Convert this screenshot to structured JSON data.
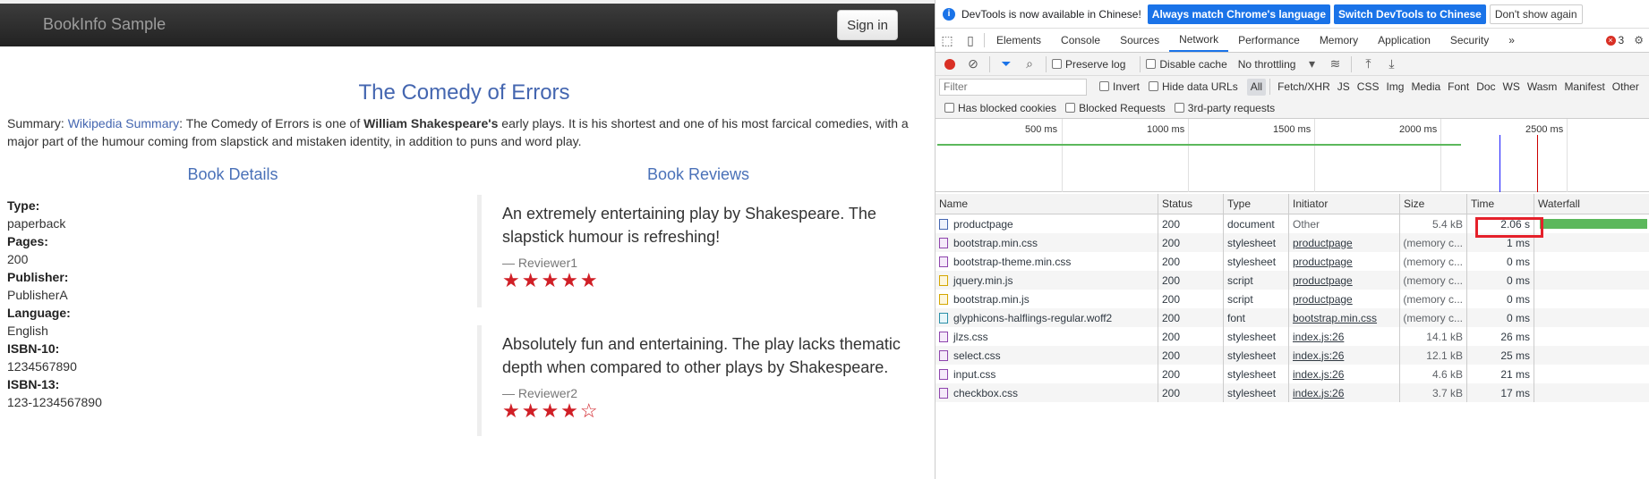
{
  "page": {
    "brand": "BookInfo Sample",
    "signin_label": "Sign in",
    "title": "The Comedy of Errors",
    "summary_prefix": "Summary: ",
    "summary_link": "Wikipedia Summary",
    "summary_text1": ": The Comedy of Errors is one of ",
    "summary_bold": "William Shakespeare's",
    "summary_text2": " early plays. It is his shortest and one of his most farcical comedies, with a major part of the humour coming from slapstick and mistaken identity, in addition to puns and word play.",
    "details_heading": "Book Details",
    "reviews_heading": "Book Reviews",
    "details": [
      {
        "label": "Type:",
        "value": "paperback"
      },
      {
        "label": "Pages:",
        "value": "200"
      },
      {
        "label": "Publisher:",
        "value": "PublisherA"
      },
      {
        "label": "Language:",
        "value": "English"
      },
      {
        "label": "ISBN-10:",
        "value": "1234567890"
      },
      {
        "label": "ISBN-13:",
        "value": "123-1234567890"
      }
    ],
    "reviews": [
      {
        "text": "An extremely entertaining play by Shakespeare. The slapstick humour is refreshing!",
        "author": "— Reviewer1",
        "rating": 5,
        "max": 5
      },
      {
        "text": "Absolutely fun and entertaining. The play lacks thematic depth when compared to other plays by Shakespeare.",
        "author": "— Reviewer2",
        "rating": 4,
        "max": 5
      }
    ],
    "star_color": "#d01f26"
  },
  "devtools": {
    "info_message": "DevTools is now available in Chinese!",
    "btn_match": "Always match Chrome's language",
    "btn_switch": "Switch DevTools to Chinese",
    "btn_dismiss": "Don't show again",
    "tabs": [
      "Elements",
      "Console",
      "Sources",
      "Network",
      "Performance",
      "Memory",
      "Application",
      "Security"
    ],
    "active_tab": "Network",
    "more_tabs": "»",
    "error_count": "3",
    "preserve_log": "Preserve log",
    "disable_cache": "Disable cache",
    "throttling": "No throttling",
    "filter_placeholder": "Filter",
    "invert": "Invert",
    "hide_data_urls": "Hide data URLs",
    "type_filters": [
      "All",
      "Fetch/XHR",
      "JS",
      "CSS",
      "Img",
      "Media",
      "Font",
      "Doc",
      "WS",
      "Wasm",
      "Manifest",
      "Other"
    ],
    "active_type": "All",
    "has_blocked_cookies": "Has blocked cookies",
    "blocked_requests": "Blocked Requests",
    "third_party": "3rd-party requests",
    "overview_labels": [
      "500 ms",
      "1000 ms",
      "1500 ms",
      "2000 ms",
      "2500 ms"
    ],
    "columns": [
      "Name",
      "Status",
      "Type",
      "Initiator",
      "Size",
      "Time",
      "Waterfall"
    ],
    "rows": [
      {
        "name": "productpage",
        "icon": "doc",
        "status": "200",
        "type": "document",
        "initiator": "Other",
        "initiator_link": false,
        "size": "5.4 kB",
        "time": "2.06 s"
      },
      {
        "name": "bootstrap.min.css",
        "icon": "css",
        "status": "200",
        "type": "stylesheet",
        "initiator": "productpage",
        "initiator_link": true,
        "size": "(memory c...",
        "time": "1 ms"
      },
      {
        "name": "bootstrap-theme.min.css",
        "icon": "css",
        "status": "200",
        "type": "stylesheet",
        "initiator": "productpage",
        "initiator_link": true,
        "size": "(memory c...",
        "time": "0 ms"
      },
      {
        "name": "jquery.min.js",
        "icon": "js",
        "status": "200",
        "type": "script",
        "initiator": "productpage",
        "initiator_link": true,
        "size": "(memory c...",
        "time": "0 ms"
      },
      {
        "name": "bootstrap.min.js",
        "icon": "js",
        "status": "200",
        "type": "script",
        "initiator": "productpage",
        "initiator_link": true,
        "size": "(memory c...",
        "time": "0 ms"
      },
      {
        "name": "glyphicons-halflings-regular.woff2",
        "icon": "font",
        "status": "200",
        "type": "font",
        "initiator": "bootstrap.min.css",
        "initiator_link": true,
        "size": "(memory c...",
        "time": "0 ms"
      },
      {
        "name": "jlzs.css",
        "icon": "css",
        "status": "200",
        "type": "stylesheet",
        "initiator": "index.js:26",
        "initiator_link": true,
        "size": "14.1 kB",
        "time": "26 ms"
      },
      {
        "name": "select.css",
        "icon": "css",
        "status": "200",
        "type": "stylesheet",
        "initiator": "index.js:26",
        "initiator_link": true,
        "size": "12.1 kB",
        "time": "25 ms"
      },
      {
        "name": "input.css",
        "icon": "css",
        "status": "200",
        "type": "stylesheet",
        "initiator": "index.js:26",
        "initiator_link": true,
        "size": "4.6 kB",
        "time": "21 ms"
      },
      {
        "name": "checkbox.css",
        "icon": "css",
        "status": "200",
        "type": "stylesheet",
        "initiator": "index.js:26",
        "initiator_link": true,
        "size": "3.7 kB",
        "time": "17 ms"
      }
    ],
    "highlight_color": "#e5212b",
    "waterfall_color": "#5cb85c"
  }
}
